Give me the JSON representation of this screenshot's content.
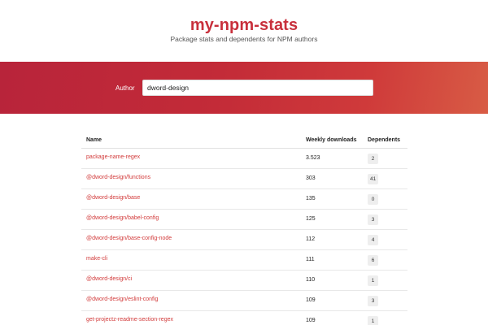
{
  "header": {
    "title": "my-npm-stats",
    "subtitle": "Package stats and dependents for NPM authors"
  },
  "search": {
    "label": "Author",
    "value": "dword-design"
  },
  "colors": {
    "accent": "#c8303c",
    "link": "#d23a3a",
    "banner_start": "#b8243a",
    "banner_end": "#d85c45"
  },
  "table": {
    "columns": [
      "Name",
      "Weekly downloads",
      "Dependents"
    ],
    "rows": [
      {
        "name": "package-name-regex",
        "weekly": "3.523",
        "dependents": "2"
      },
      {
        "name": "@dword-design/functions",
        "weekly": "303",
        "dependents": "41"
      },
      {
        "name": "@dword-design/base",
        "weekly": "135",
        "dependents": "0"
      },
      {
        "name": "@dword-design/babel-config",
        "weekly": "125",
        "dependents": "3"
      },
      {
        "name": "@dword-design/base-config-node",
        "weekly": "112",
        "dependents": "4"
      },
      {
        "name": "make-cli",
        "weekly": "111",
        "dependents": "6"
      },
      {
        "name": "@dword-design/ci",
        "weekly": "110",
        "dependents": "1"
      },
      {
        "name": "@dword-design/eslint-config",
        "weekly": "109",
        "dependents": "3"
      },
      {
        "name": "get-projectz-readme-section-regex",
        "weekly": "109",
        "dependents": "1"
      }
    ]
  }
}
